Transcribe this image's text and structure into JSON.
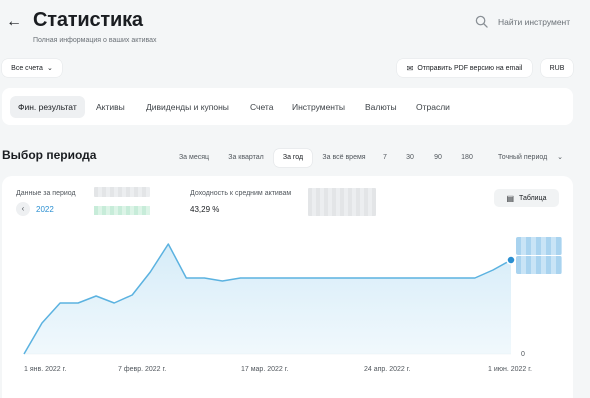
{
  "header": {
    "title": "Статистика",
    "subtitle": "Полная информация о ваших активах",
    "search_label": "Найти инструмент"
  },
  "toolbar": {
    "accounts_label": "Все счета",
    "pdf_label": "Отправить PDF версию на email",
    "currency_label": "RUB"
  },
  "tabs": [
    {
      "label": "Фин. результат",
      "active": true
    },
    {
      "label": "Активы"
    },
    {
      "label": "Дивиденды и купоны"
    },
    {
      "label": "Счета"
    },
    {
      "label": "Инструменты"
    },
    {
      "label": "Валюты"
    },
    {
      "label": "Отрасли"
    }
  ],
  "period": {
    "title": "Выбор периода",
    "options": [
      {
        "label": "За месяц"
      },
      {
        "label": "За квартал"
      },
      {
        "label": "За год",
        "active": true
      },
      {
        "label": "За всё время"
      },
      {
        "label": "7"
      },
      {
        "label": "30"
      },
      {
        "label": "90"
      },
      {
        "label": "180"
      }
    ],
    "exact_label": "Точный период"
  },
  "stats": {
    "period_label": "Данные за период",
    "year": "2022",
    "yield_label": "Доходность к средним активам",
    "yield_value": "43,29 %",
    "table_button": "Таблица"
  },
  "colors": {
    "accent": "#2b8fd1",
    "line": "#5bb2e0",
    "area": "#d6ecf8"
  },
  "chart_data": {
    "type": "area",
    "x_ticks": [
      "1 янв. 2022 г.",
      "7 февр. 2022 г.",
      "17 мар. 2022 г.",
      "24 апр. 2022 г.",
      "1 июн. 2022 г."
    ],
    "y_ticks": [
      "0"
    ],
    "x_days": [
      0,
      6,
      12,
      18,
      24,
      30,
      36,
      42,
      48,
      54,
      60,
      66,
      72,
      78,
      84,
      90,
      96,
      102,
      108,
      114,
      120,
      126,
      132,
      138,
      144,
      150,
      156,
      162
    ],
    "values": [
      0,
      31,
      51,
      51,
      58,
      51,
      59,
      82,
      110,
      76,
      76,
      73,
      76,
      76,
      76,
      76,
      76,
      76,
      76,
      76,
      76,
      76,
      76,
      76,
      76,
      76,
      84,
      94
    ],
    "ylim": [
      0,
      120
    ],
    "grid": false,
    "last_point_marker": true,
    "note": "y values are relative; the actual numeric labels on the y-axis are blurred in the original"
  }
}
